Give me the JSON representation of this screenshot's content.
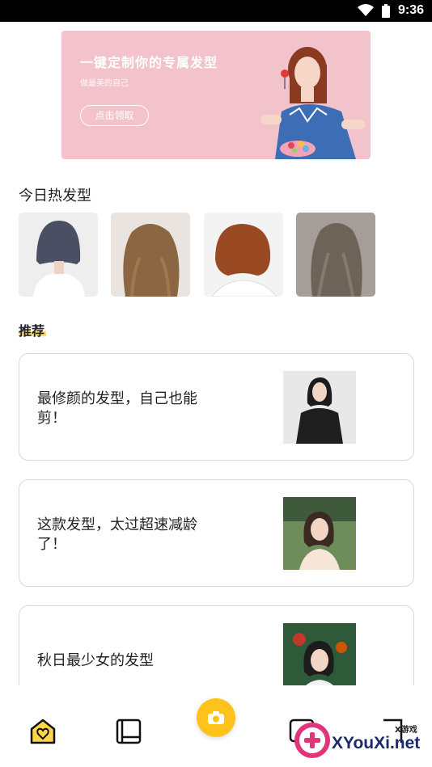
{
  "status_bar": {
    "time": "9:36"
  },
  "banner": {
    "title": "一键定制你的专属发型",
    "subtitle": "做最美的自己",
    "button_label": "点击领取"
  },
  "hot_section": {
    "title": "今日热发型",
    "items": [
      {
        "icon": "hairstyle-photo-bob-gray"
      },
      {
        "icon": "hairstyle-photo-long-wavy-brown"
      },
      {
        "icon": "hairstyle-photo-short-curly-auburn"
      },
      {
        "icon": "hairstyle-photo-long-wavy-ash"
      }
    ]
  },
  "recommend": {
    "title": "推荐",
    "cards": [
      {
        "text": "最修颜的发型，自己也能剪！"
      },
      {
        "text": "这款发型，太过超速减龄了！"
      },
      {
        "text": "秋日最少女的发型"
      }
    ]
  },
  "bottom_nav": {
    "items": [
      "home-heart-icon",
      "book-icon",
      "camera-icon",
      "chat-icon",
      "profile-icon"
    ]
  },
  "watermark": {
    "text": "XYouXi.net",
    "small": "X游戏"
  },
  "colors": {
    "accent": "#ffc21a",
    "banner_bg": "#f2c3cb"
  }
}
